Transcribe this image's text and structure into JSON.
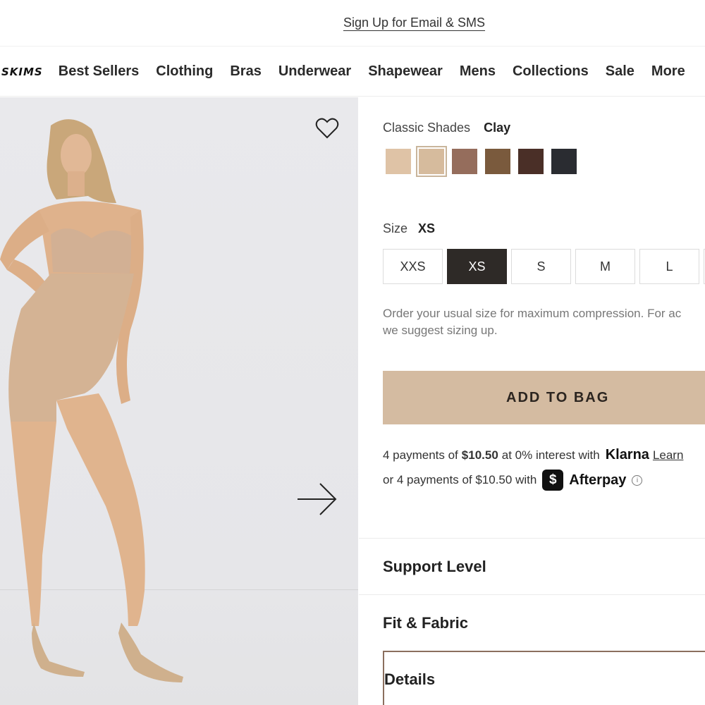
{
  "promo": {
    "signup_link": "Sign Up for Email & SMS"
  },
  "nav": {
    "logo": "SKIMS",
    "items": [
      "Best Sellers",
      "Clothing",
      "Bras",
      "Underwear",
      "Shapewear",
      "Mens",
      "Collections",
      "Sale",
      "More"
    ]
  },
  "product": {
    "shade_label": "Classic Shades",
    "selected_shade": "Clay",
    "swatch_colors": [
      "#dfc3a6",
      "#d6bb9d",
      "#956d5c",
      "#7a5a3d",
      "#4a2f27",
      "#2a2c31"
    ],
    "selected_swatch_index": 1,
    "size_label": "Size",
    "selected_size": "XS",
    "sizes": [
      "XXS",
      "XS",
      "S",
      "M",
      "L"
    ],
    "size_note_line1": "Order your usual size for maximum compression. For ac",
    "size_note_line2": "we suggest sizing up.",
    "add_to_bag": "ADD TO BAG"
  },
  "payments": {
    "klarna_prefix": "4 payments of",
    "klarna_amount": "$10.50",
    "klarna_suffix": "at 0% interest with",
    "klarna_brand": "Klarna",
    "klarna_learn": "Learn",
    "afterpay_text": "or 4 payments of $10.50 with",
    "afterpay_icon_glyph": "$",
    "afterpay_brand": "Afterpay",
    "info_glyph": "i"
  },
  "accordion": [
    "Support Level",
    "Fit & Fabric",
    "Details"
  ],
  "colors": {
    "add_to_bag_bg": "#d4bba1",
    "selected_size_bg": "#2e2a27",
    "details_outline": "#8b6f5e"
  }
}
